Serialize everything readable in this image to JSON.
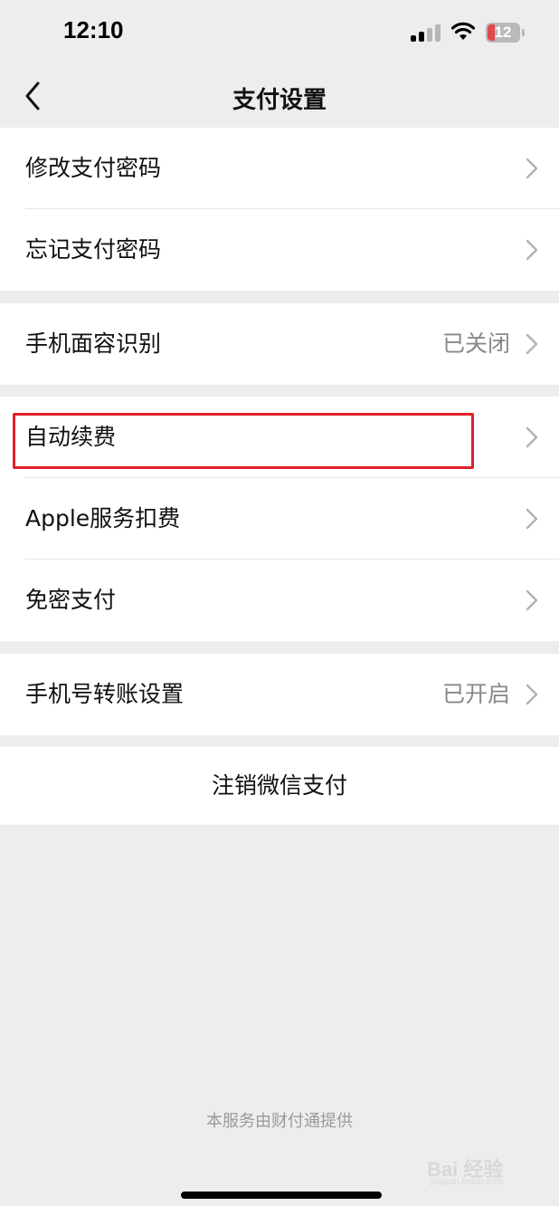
{
  "status_bar": {
    "time": "12:10",
    "battery_level": "12",
    "icons": [
      "signal-icon",
      "wifi-icon",
      "battery-icon"
    ]
  },
  "nav": {
    "title": "支付设置",
    "back_icon": "chevron-left-icon"
  },
  "groups": [
    {
      "items": [
        {
          "label": "修改支付密码",
          "value": ""
        },
        {
          "label": "忘记支付密码",
          "value": ""
        }
      ]
    },
    {
      "items": [
        {
          "label": "手机面容识别",
          "value": "已关闭"
        }
      ]
    },
    {
      "items": [
        {
          "label": "自动续费",
          "value": "",
          "highlighted": true
        },
        {
          "label": "Apple服务扣费",
          "value": ""
        },
        {
          "label": "免密支付",
          "value": ""
        }
      ]
    },
    {
      "items": [
        {
          "label": "手机号转账设置",
          "value": "已开启"
        }
      ]
    }
  ],
  "danger_action": {
    "label": "注销微信支付"
  },
  "footer": {
    "text": "本服务由财付通提供"
  },
  "watermark": {
    "text": "Bai 经验",
    "sub": "jingyan.baidu.com"
  },
  "colors": {
    "background": "#ededed",
    "highlight": "#e0202a",
    "secondary_text": "#888888"
  }
}
